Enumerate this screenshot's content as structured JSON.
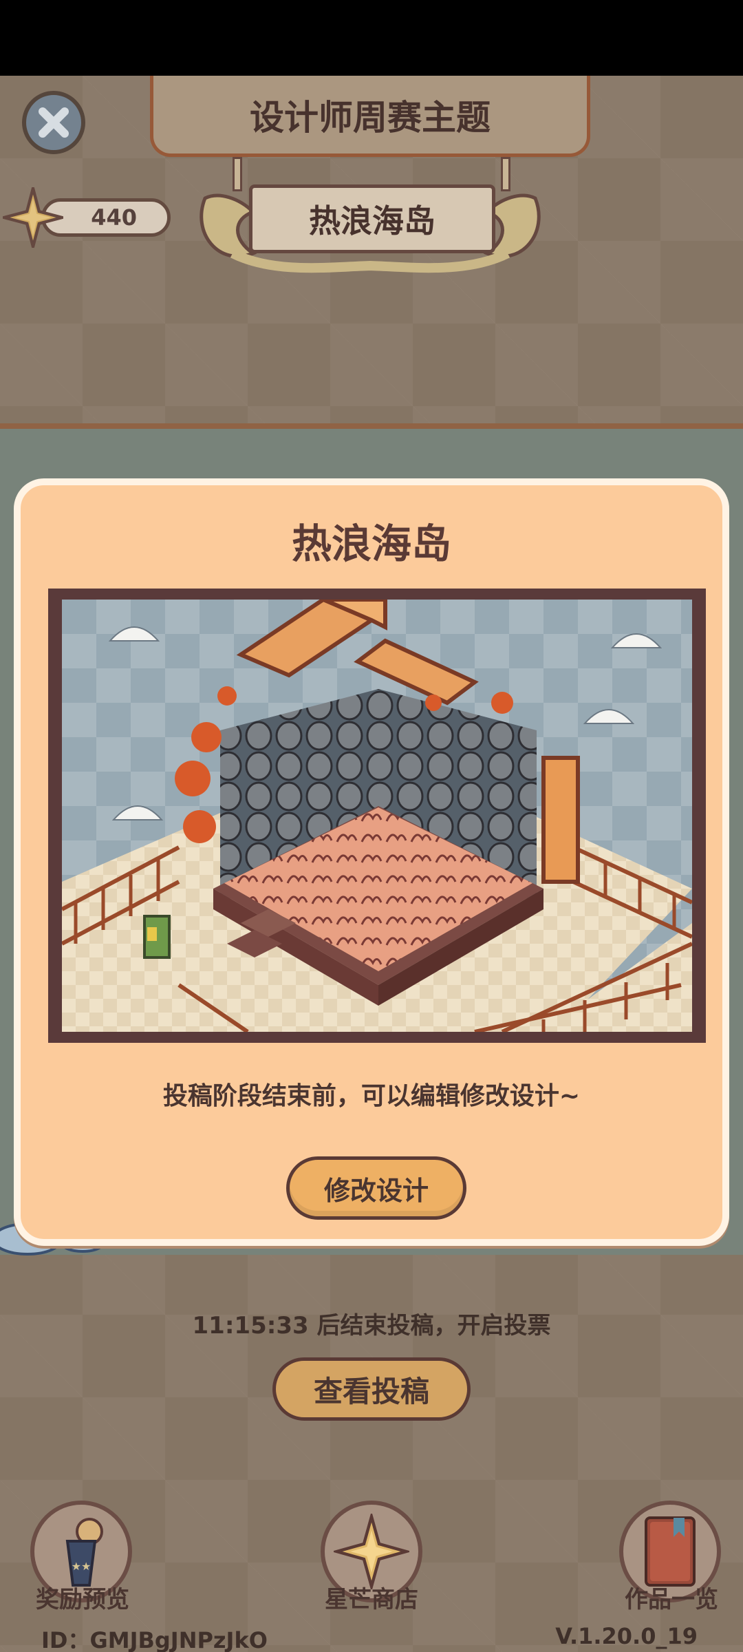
{
  "header": {
    "title": "设计师周赛主题",
    "star_count": "440",
    "theme_sign": "热浪海岛"
  },
  "modal": {
    "title": "热浪海岛",
    "note": "投稿阶段结束前，可以编辑修改设计~",
    "edit_button": "修改设计"
  },
  "countdown": "11:15:33 后结束投稿，开启投票",
  "view_button": "查看投稿",
  "nav": {
    "items": [
      {
        "label": "奖励预览",
        "icon": "trophy-icon"
      },
      {
        "label": "星芒商店",
        "icon": "star-shop-icon"
      },
      {
        "label": "作品一览",
        "icon": "book-icon"
      }
    ]
  },
  "footer": {
    "id": "ID：GMJBgJNPzJkO",
    "version": "V.1.20.0_19"
  },
  "colors": {
    "modal_bg": "#fccb9b",
    "button_orange": "#eeb064",
    "text_dark": "#4a3530"
  }
}
